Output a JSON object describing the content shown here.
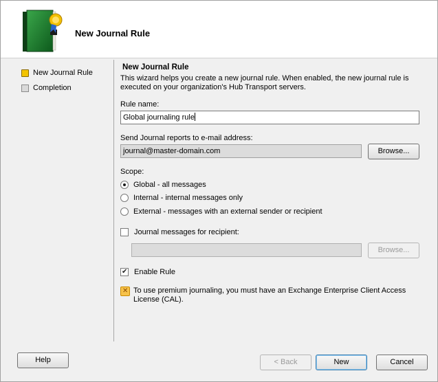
{
  "header": {
    "title": "New Journal Rule",
    "icon": "journal-book-icon"
  },
  "steps": [
    {
      "label": "New Journal Rule",
      "active": true
    },
    {
      "label": "Completion",
      "active": false
    }
  ],
  "content": {
    "section_title": "New Journal Rule",
    "description": "This wizard helps you create a new journal rule. When enabled, the new journal rule is executed on your organization's Hub Transport servers.",
    "rule_name_label": "Rule name:",
    "rule_name_value": "Global journaling rule",
    "send_reports_label": "Send Journal reports to e-mail address:",
    "send_reports_value": "journal@master-domain.com",
    "browse_label": "Browse...",
    "scope_label": "Scope:",
    "scope_options": [
      {
        "label": "Global - all messages",
        "checked": true
      },
      {
        "label": "Internal - internal messages only",
        "checked": false
      },
      {
        "label": "External - messages with an external sender or recipient",
        "checked": false
      }
    ],
    "journal_recipient_label": "Journal messages for recipient:",
    "journal_recipient_checked": false,
    "journal_recipient_value": "",
    "browse2_label": "Browse...",
    "enable_rule_label": "Enable Rule",
    "enable_rule_checked": true,
    "warning_text": "To use premium journaling, you must have an Exchange Enterprise Client Access License (CAL)."
  },
  "footer": {
    "help_label": "Help",
    "back_label": "< Back",
    "new_label": "New",
    "cancel_label": "Cancel"
  },
  "colors": {
    "header_bg": "#ffffff",
    "body_bg": "#f0f0f0",
    "active_step": "#f3c400",
    "warning_icon": "#f7c24a"
  }
}
